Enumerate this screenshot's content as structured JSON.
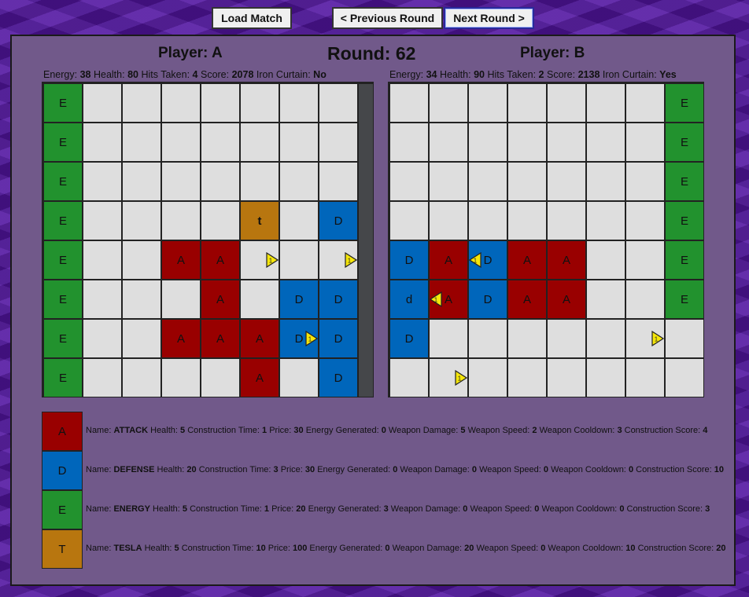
{
  "toolbar": {
    "load_label": "Load Match",
    "prev_label": "< Previous Round",
    "next_label": "Next Round >"
  },
  "round": {
    "label": "Round:",
    "value": "62"
  },
  "player_a": {
    "title": "Player: A",
    "energy": "38",
    "health": "80",
    "hits_taken": "4",
    "score": "2078",
    "iron_curtain": "No",
    "grid": [
      [
        "E",
        "",
        "",
        "",
        "",
        "",
        "",
        ""
      ],
      [
        "E",
        "",
        "",
        "",
        "",
        "",
        "",
        ""
      ],
      [
        "E",
        "",
        "",
        "",
        "",
        "",
        "",
        ""
      ],
      [
        "E",
        "",
        "",
        "",
        "",
        "t",
        "",
        "D"
      ],
      [
        "E",
        "",
        "",
        "A",
        "A",
        "",
        "",
        ""
      ],
      [
        "E",
        "",
        "",
        "",
        "A",
        "",
        "D",
        "D"
      ],
      [
        "E",
        "",
        "",
        "A",
        "A",
        "A",
        "D",
        "D"
      ],
      [
        "E",
        "",
        "",
        "",
        "",
        "A",
        "",
        "D"
      ]
    ],
    "missiles": [
      {
        "row": 4,
        "col": 5,
        "dir": "right"
      },
      {
        "row": 4,
        "col": 7,
        "dir": "right"
      },
      {
        "row": 6,
        "col": 6,
        "dir": "right"
      }
    ]
  },
  "player_b": {
    "title": "Player: B",
    "energy": "34",
    "health": "90",
    "hits_taken": "2",
    "score": "2138",
    "iron_curtain": "Yes",
    "grid": [
      [
        "",
        "",
        "",
        "",
        "",
        "",
        "",
        "E"
      ],
      [
        "",
        "",
        "",
        "",
        "",
        "",
        "",
        "E"
      ],
      [
        "",
        "",
        "",
        "",
        "",
        "",
        "",
        "E"
      ],
      [
        "",
        "",
        "",
        "",
        "",
        "",
        "",
        "E"
      ],
      [
        "D",
        "A",
        "D",
        "A",
        "A",
        "",
        "",
        "E"
      ],
      [
        "d",
        "A",
        "D",
        "A",
        "A",
        "",
        "",
        "E"
      ],
      [
        "D",
        "",
        "",
        "",
        "",
        "",
        "",
        ""
      ],
      [
        "",
        "",
        "",
        "",
        "",
        "",
        "",
        ""
      ]
    ],
    "missiles": [
      {
        "row": 4,
        "col": 2,
        "dir": "left"
      },
      {
        "row": 5,
        "col": 1,
        "dir": "left"
      },
      {
        "row": 6,
        "col": 6,
        "dir": "right"
      },
      {
        "row": 7,
        "col": 1,
        "dir": "right"
      }
    ]
  },
  "stat_labels": {
    "energy": "Energy:",
    "health": "Health:",
    "hits": "Hits Taken:",
    "score": "Score:",
    "iron": "Iron Curtain:"
  },
  "legend": [
    {
      "letter": "A",
      "color": "#990000",
      "name": "ATTACK",
      "health": "5",
      "construction_time": "1",
      "price": "30",
      "energy_generated": "0",
      "weapon_damage": "5",
      "weapon_speed": "2",
      "weapon_cooldown": "3",
      "construction_score": "4"
    },
    {
      "letter": "D",
      "color": "#0066bb",
      "name": "DEFENSE",
      "health": "20",
      "construction_time": "3",
      "price": "30",
      "energy_generated": "0",
      "weapon_damage": "0",
      "weapon_speed": "0",
      "weapon_cooldown": "0",
      "construction_score": "10"
    },
    {
      "letter": "E",
      "color": "#22922e",
      "name": "ENERGY",
      "health": "5",
      "construction_time": "1",
      "price": "20",
      "energy_generated": "3",
      "weapon_damage": "0",
      "weapon_speed": "0",
      "weapon_cooldown": "0",
      "construction_score": "3"
    },
    {
      "letter": "T",
      "color": "#b8760f",
      "name": "TESLA",
      "health": "5",
      "construction_time": "10",
      "price": "100",
      "energy_generated": "0",
      "weapon_damage": "20",
      "weapon_speed": "0",
      "weapon_cooldown": "10",
      "construction_score": "20"
    }
  ],
  "legend_labels": {
    "name": "Name:",
    "health": "Health:",
    "construction_time": "Construction Time:",
    "price": "Price:",
    "energy_generated": "Energy Generated:",
    "weapon_damage": "Weapon Damage:",
    "weapon_speed": "Weapon Speed:",
    "weapon_cooldown": "Weapon Cooldown:",
    "construction_score": "Construction Score:"
  },
  "missile_glyph": "1",
  "colors": {
    "attack": "#990000",
    "defense": "#0066bb",
    "energy": "#22922e",
    "tesla": "#b8760f",
    "empty": "#dedede",
    "missile": "#f5e60a"
  }
}
